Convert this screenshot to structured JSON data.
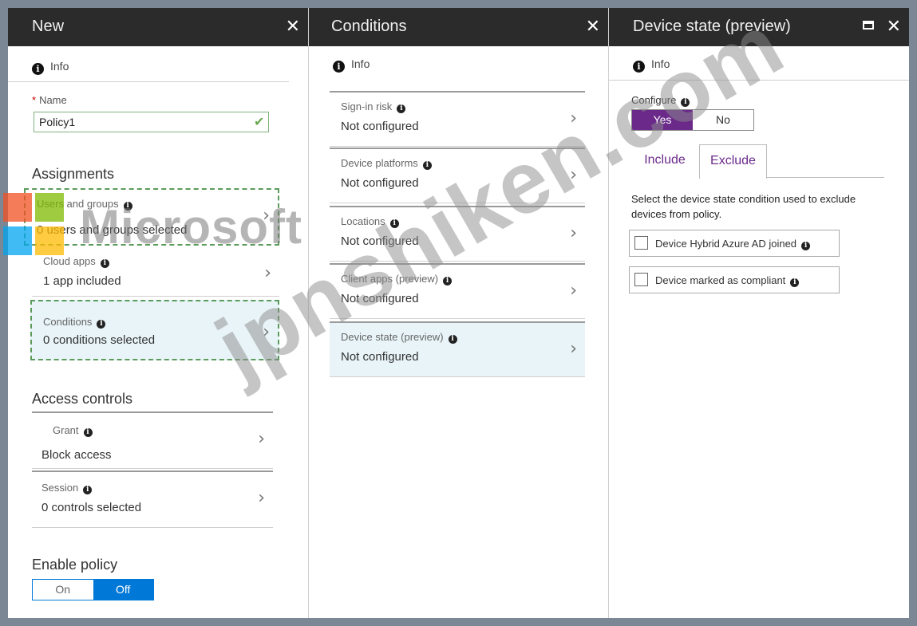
{
  "new_blade": {
    "title": "New",
    "info": "Info",
    "name_label": "Name",
    "name_value": "Policy1",
    "assignments_title": "Assignments",
    "users": {
      "label": "Users and groups",
      "value": "0 users and groups selected"
    },
    "cloud_apps": {
      "label": "Cloud apps",
      "value": "1 app included"
    },
    "conditions": {
      "label": "Conditions",
      "value": "0  conditions  selected"
    },
    "access_controls_title": "Access controls",
    "grant": {
      "label": "Grant",
      "value": "Block access"
    },
    "session": {
      "label": "Session",
      "value": "0 controls selected"
    },
    "enable_policy_title": "Enable policy",
    "enable_on": "On",
    "enable_off": "Off",
    "enable_selected": "Off"
  },
  "conditions_blade": {
    "title": "Conditions",
    "info": "Info",
    "items": [
      {
        "label": "Sign-in risk",
        "value": "Not configured"
      },
      {
        "label": "Device platforms",
        "value": "Not configured"
      },
      {
        "label": "Locations",
        "value": "Not configured"
      },
      {
        "label": "Client apps (preview)",
        "value": "Not configured"
      },
      {
        "label": "Device state (preview)",
        "value": "Not configured"
      }
    ]
  },
  "device_state_blade": {
    "title": "Device state (preview)",
    "info": "Info",
    "configure_label": "Configure",
    "yes": "Yes",
    "no": "No",
    "configure_selected": "Yes",
    "tabs": [
      "Include",
      "Exclude"
    ],
    "active_tab": "Exclude",
    "description": "Select the device state condition used to exclude devices from policy.",
    "options": [
      {
        "label": "Device Hybrid Azure AD joined",
        "checked": false
      },
      {
        "label": "Device marked as compliant",
        "checked": false
      }
    ]
  },
  "watermarks": {
    "brand": "Microsoft",
    "site": "jpnshiken.com"
  },
  "colors": {
    "accent_blue": "#0078d7",
    "accent_purple": "#6b2a8a",
    "header": "#2b2b2b"
  }
}
